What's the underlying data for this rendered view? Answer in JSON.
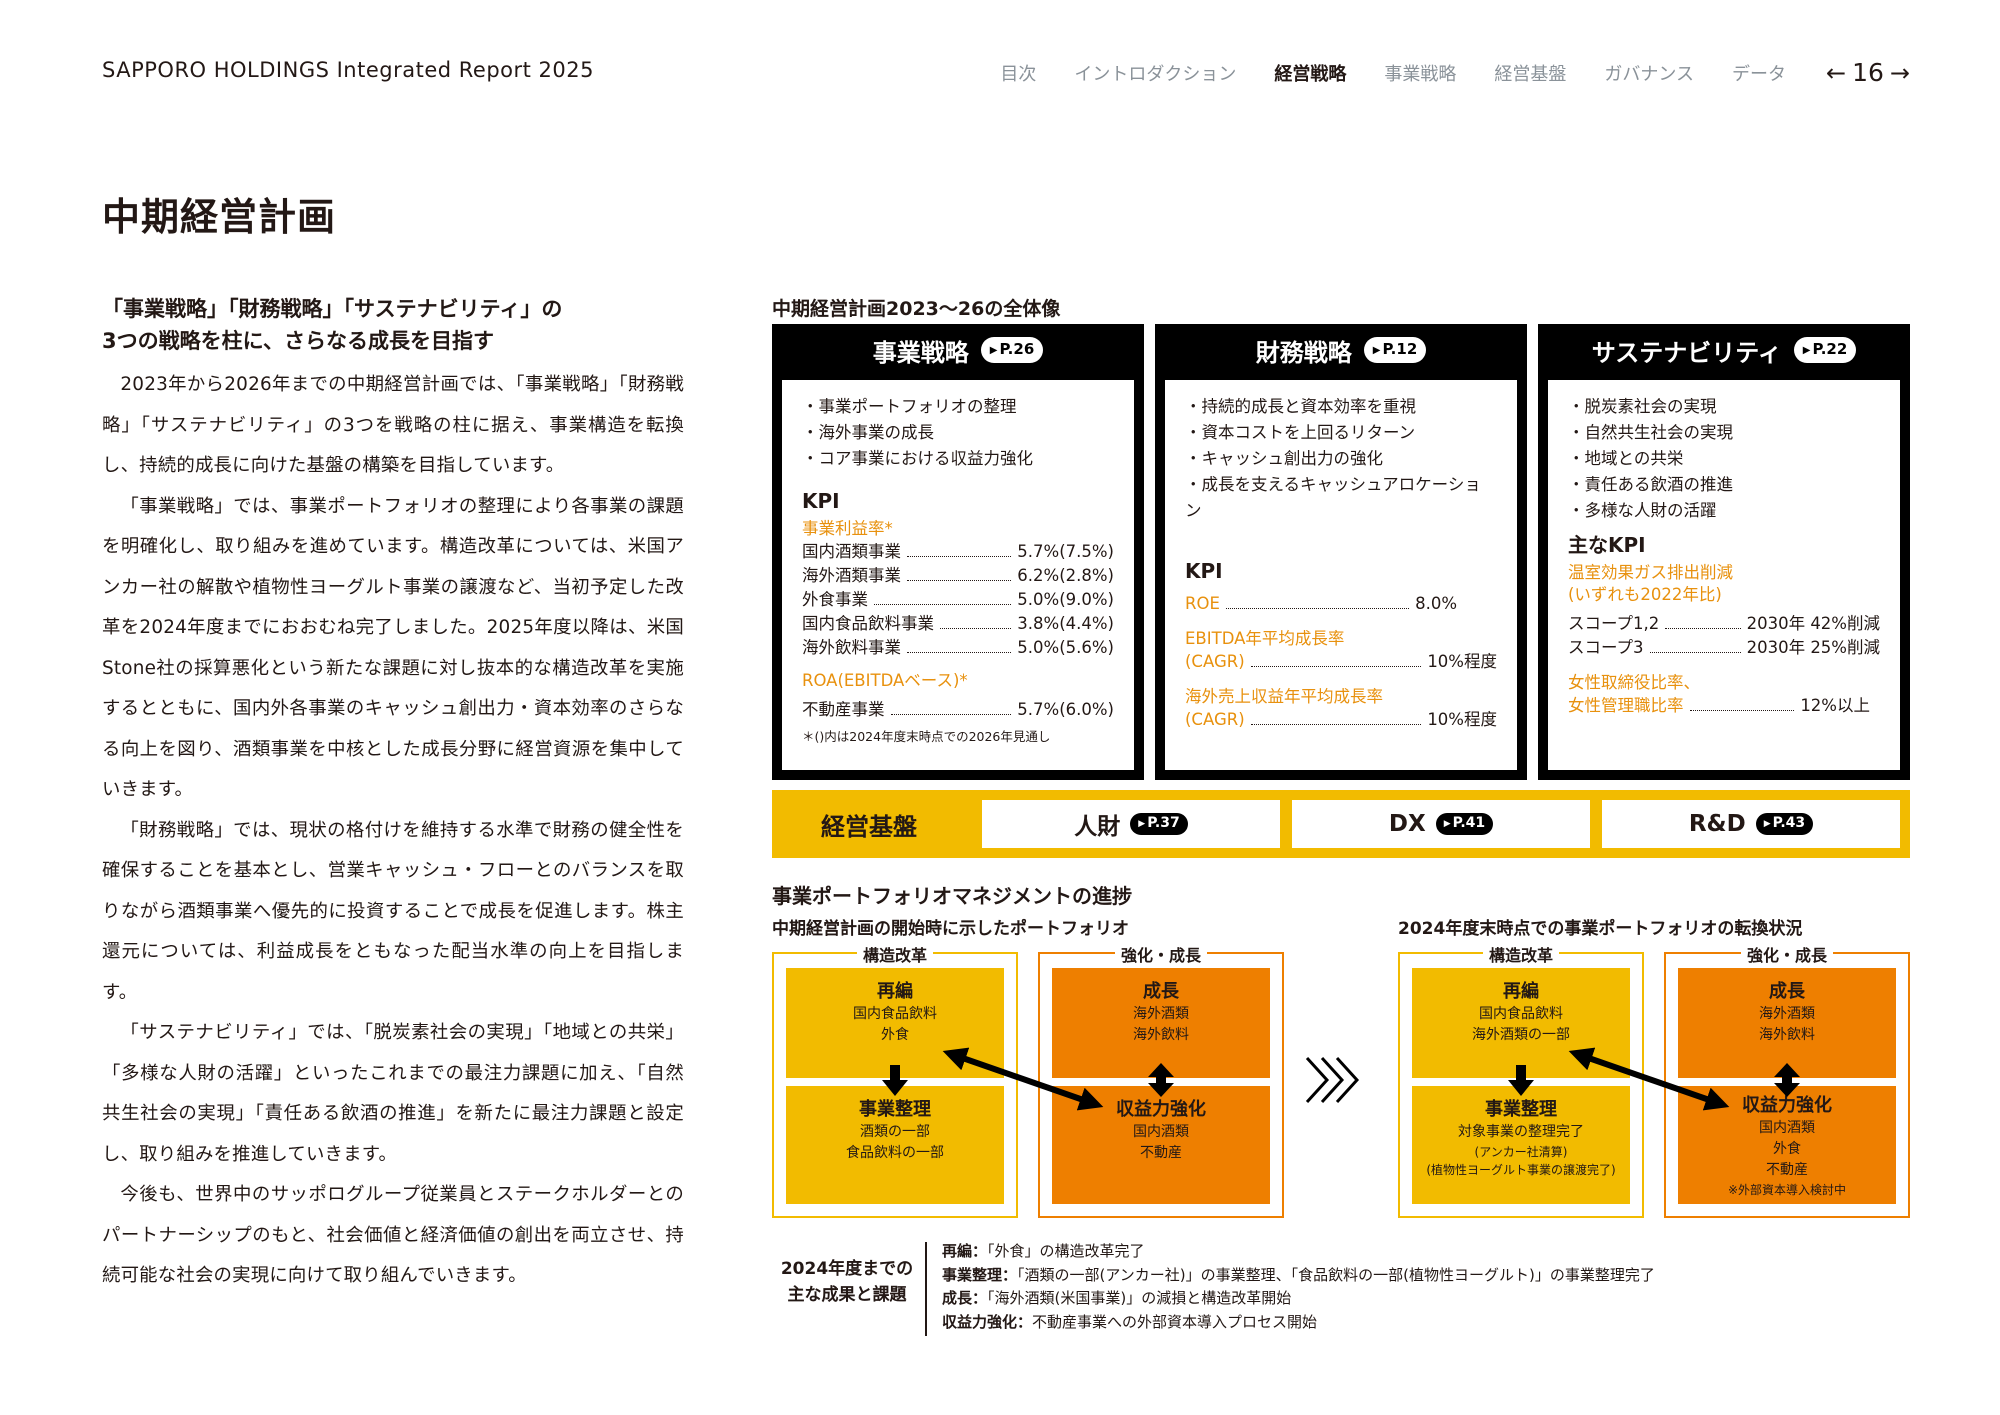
{
  "header": {
    "report_title": "SAPPORO HOLDINGS Integrated Report 2025",
    "nav": [
      "目次",
      "イントロダクション",
      "経営戦略",
      "事業戦略",
      "経営基盤",
      "ガバナンス",
      "データ"
    ],
    "active_nav": "経営戦略",
    "page_number": "16"
  },
  "page_heading": "中期経営計画",
  "left": {
    "heading_line1": "「事業戦略」「財務戦略」「サステナビリティ」の",
    "heading_line2": "3つの戦略を柱に、さらなる成長を目指す",
    "paragraphs": [
      "2023年から2026年までの中期経営計画では、「事業戦略」「財務戦略」「サステナビリティ」の3つを戦略の柱に据え、事業構造を転換し、持続的成長に向けた基盤の構築を目指しています。",
      "「事業戦略」では、事業ポートフォリオの整理により各事業の課題を明確化し、取り組みを進めています。構造改革については、米国アンカー社の解散や植物性ヨーグルト事業の譲渡など、当初予定した改革を2024年度までにおおむね完了しました。2025年度以降は、米国Stone社の採算悪化という新たな課題に対し抜本的な構造改革を実施するとともに、国内外各事業のキャッシュ創出力・資本効率のさらなる向上を図り、酒類事業を中核とした成長分野に経営資源を集中していきます。",
      "「財務戦略」では、現状の格付けを維持する水準で財務の健全性を確保することを基本とし、営業キャッシュ・フローとのバランスを取りながら酒類事業へ優先的に投資することで成長を促進します。株主還元については、利益成長をともなった配当水準の向上を目指します。",
      "「サステナビリティ」では、「脱炭素社会の実現」「地域との共栄」「多様な人財の活躍」といったこれまでの最注力課題に加え、「自然共生社会の実現」「責任ある飲酒の推進」を新たに最注力課題と設定し、取り組みを推進していきます。",
      "今後も、世界中のサッポログループ従業員とステークホルダーとのパートナーシップのもと、社会価値と経済価値の創出を両立させ、持続可能な社会の実現に向けて取り組んでいきます。"
    ]
  },
  "overview": {
    "label": "中期経営計画2023～26の全体像",
    "business": {
      "title": "事業戦略",
      "ref": "P.26",
      "bullets": [
        "・事業ポートフォリオの整理",
        "・海外事業の成長",
        "・コア事業における収益力強化"
      ],
      "kpi_heading": "KPI",
      "kpi1_title": "事業利益率*",
      "kpi1_rows": [
        {
          "label": "国内酒類事業",
          "value": "5.7%(7.5%)"
        },
        {
          "label": "海外酒類事業",
          "value": "6.2%(2.8%)"
        },
        {
          "label": "外食事業",
          "value": "5.0%(9.0%)"
        },
        {
          "label": "国内食品飲料事業",
          "value": "3.8%(4.4%)"
        },
        {
          "label": "海外飲料事業",
          "value": "5.0%(5.6%)"
        }
      ],
      "kpi2_title": "ROA(EBITDAベース)*",
      "kpi2_rows": [
        {
          "label": "不動産事業",
          "value": "5.7%(6.0%)"
        }
      ],
      "footnote": "＊()内は2024年度末時点での2026年見通し"
    },
    "finance": {
      "title": "財務戦略",
      "ref": "P.12",
      "bullets": [
        "・持続的成長と資本効率を重視",
        "・資本コストを上回るリターン",
        "・キャッシュ創出力の強化",
        "・成長を支えるキャッシュアロケーション"
      ],
      "kpi_heading": "KPI",
      "roe_label": "ROE",
      "roe_value": "8.0%",
      "ebitda_line1": "EBITDA年平均成長率",
      "ebitda_line2": "(CAGR)",
      "ebitda_value": "10%程度",
      "sales_line1": "海外売上収益年平均成長率",
      "sales_line2": "(CAGR)",
      "sales_value": "10%程度"
    },
    "sustainability": {
      "title": "サステナビリティ",
      "ref": "P.22",
      "bullets": [
        "・脱炭素社会の実現",
        "・自然共生社会の実現",
        "・地域との共栄",
        "・責任ある飲酒の推進",
        "・多様な人財の活躍"
      ],
      "kpi_heading": "主なKPI",
      "ghg_line1": "温室効果ガス排出削減",
      "ghg_line2": "(いずれも2022年比)",
      "scope_rows": [
        {
          "label": "スコープ1,2",
          "value": "2030年 42%削減"
        },
        {
          "label": "スコープ3",
          "value": "2030年 25%削減"
        }
      ],
      "women_line1": "女性取締役比率、",
      "women_line2": "女性管理職比率",
      "women_value": "12%以上"
    },
    "foundation": {
      "label": "経営基盤",
      "items": [
        {
          "name": "人財",
          "ref": "P.37"
        },
        {
          "name": "DX",
          "ref": "P.41"
        },
        {
          "name": "R&D",
          "ref": "P.43"
        }
      ]
    }
  },
  "portfolio": {
    "heading": "事業ポートフォリオマネジメントの進捗",
    "left_caption": "中期経営計画の開始時に示したポートフォリオ",
    "right_caption": "2024年度末時点での事業ポートフォリオの転換状況",
    "frame_labels": [
      "構造改革",
      "強化・成長"
    ],
    "before": {
      "reorg": {
        "title": "再編",
        "items": [
          "国内食品飲料",
          "外食"
        ]
      },
      "cleanup": {
        "title": "事業整理",
        "items": [
          "酒類の一部",
          "食品飲料の一部"
        ]
      },
      "growth": {
        "title": "成長",
        "items": [
          "海外酒類",
          "海外飲料"
        ]
      },
      "profit": {
        "title": "収益力強化",
        "items": [
          "国内酒類",
          "不動産"
        ]
      }
    },
    "after": {
      "reorg": {
        "title": "再編",
        "items": [
          "国内食品飲料",
          "海外酒類の一部"
        ]
      },
      "cleanup": {
        "title": "事業整理",
        "items": [
          "対象事業の整理完了"
        ],
        "notes": [
          "(アンカー社清算)",
          "(植物性ヨーグルト事業の譲渡完了)"
        ]
      },
      "growth": {
        "title": "成長",
        "items": [
          "海外酒類",
          "海外飲料"
        ]
      },
      "profit": {
        "title": "収益力強化",
        "items": [
          "国内酒類",
          "外食",
          "不動産"
        ],
        "notes": [
          "※外部資本導入検討中"
        ]
      }
    }
  },
  "results": {
    "title_line1": "2024年度までの",
    "title_line2": "主な成果と課題",
    "items": [
      {
        "term": "再編：",
        "text": "「外食」の構造改革完了"
      },
      {
        "term": "事業整理：",
        "text": "「酒類の一部(アンカー社)」の事業整理、「食品飲料の一部(植物性ヨーグルト)」の事業整理完了"
      },
      {
        "term": "成長：",
        "text": "「海外酒類(米国事業)」の減損と構造改革開始"
      },
      {
        "term": "収益力強化：",
        "text": "不動産事業への外部資本導入プロセス開始"
      }
    ]
  },
  "colors": {
    "accent_yellow": "#f2bb00",
    "accent_orange": "#ee7f00",
    "kpi_orange": "#e8910e",
    "nav_gray": "#8a9299"
  }
}
